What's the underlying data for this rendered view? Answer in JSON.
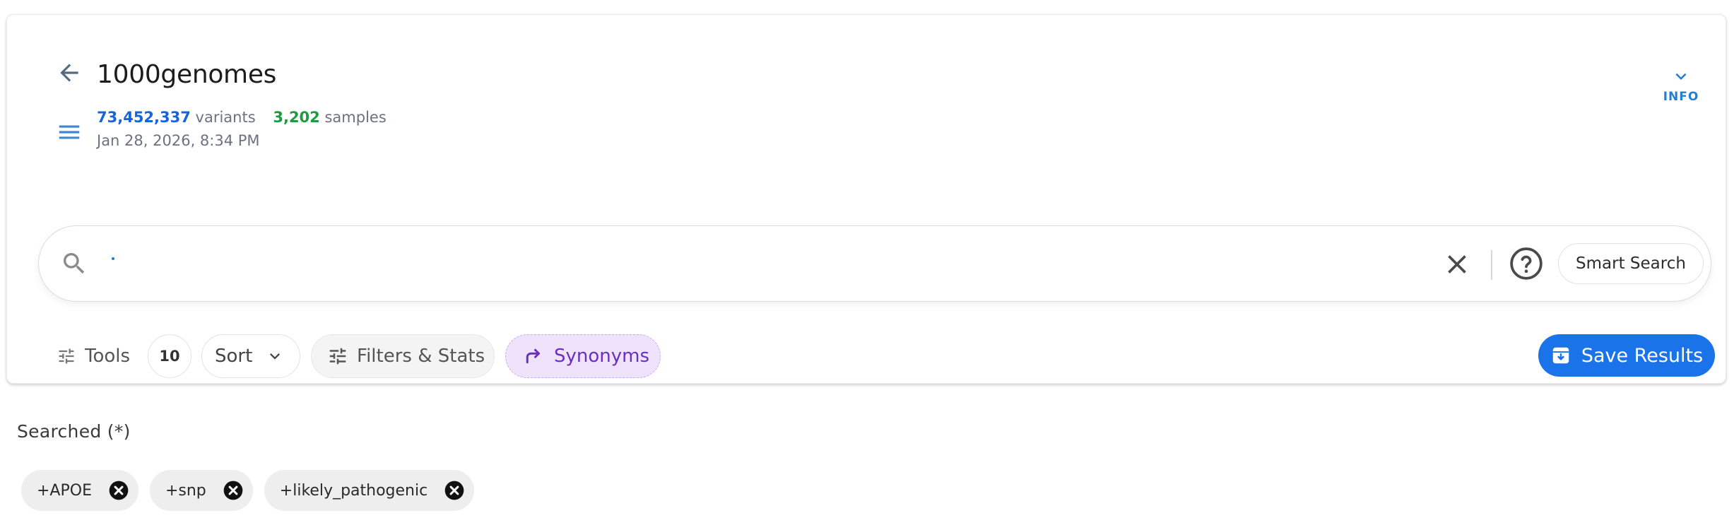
{
  "header": {
    "title": "1000genomes",
    "variant_count": "73,452,337",
    "variant_word": "variants",
    "sample_count": "3,202",
    "sample_word": "samples",
    "timestamp": "Jan 28, 2026, 8:34 PM",
    "info_label": "INFO"
  },
  "search": {
    "value": "",
    "placeholder": "",
    "smart_search_label": "Smart Search"
  },
  "toolbar": {
    "tools_label": "Tools",
    "count": "10",
    "sort_label": "Sort",
    "filters_label": "Filters & Stats",
    "synonyms_label": "Synonyms",
    "save_label": "Save Results"
  },
  "searched": {
    "label": "Searched  (*)",
    "chips": [
      {
        "label": "+APOE"
      },
      {
        "label": "+snp"
      },
      {
        "label": "+likely_pathogenic"
      }
    ]
  },
  "colors": {
    "accent": "#1a73e8",
    "variants": "#1565d8",
    "samples": "#1e9b3e",
    "synonyms_bg": "#efe3fb",
    "synonyms_text": "#6a2fbf"
  }
}
